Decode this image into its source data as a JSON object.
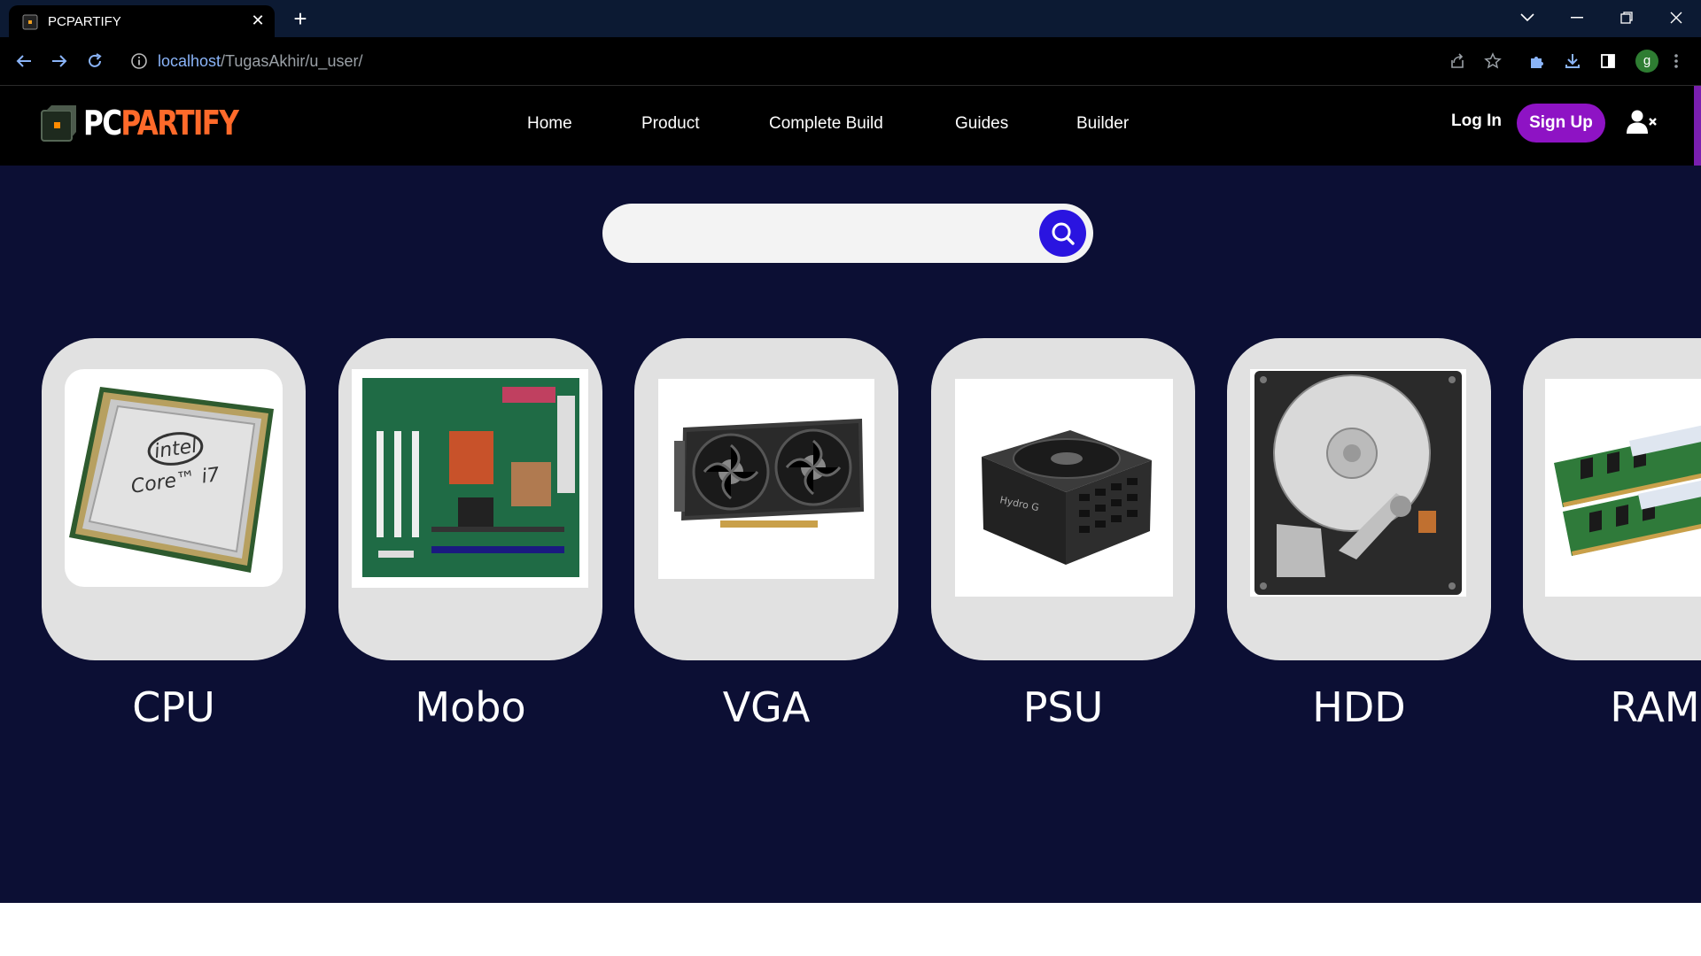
{
  "browser": {
    "tab_title": "PCPARTIFY",
    "url_host": "localhost",
    "url_path": "/TugasAkhir/u_user/",
    "profile_initial": "g"
  },
  "site": {
    "logo_pc": "PC",
    "logo_partify": "PARTIFY",
    "menu": [
      "Home",
      "Product",
      "Complete Build",
      "Guides",
      "Builder"
    ],
    "login": "Log In",
    "signup": "Sign Up"
  },
  "search": {
    "value": "",
    "placeholder": ""
  },
  "categories": [
    {
      "label": "CPU",
      "icon": "cpu-image"
    },
    {
      "label": "Mobo",
      "icon": "motherboard-image"
    },
    {
      "label": "VGA",
      "icon": "graphics-card-image"
    },
    {
      "label": "PSU",
      "icon": "power-supply-image"
    },
    {
      "label": "HDD",
      "icon": "hard-drive-image"
    },
    {
      "label": "RAM",
      "icon": "ram-image"
    }
  ],
  "colors": {
    "main_bg": "#0c0f34",
    "signup_bg": "#8e13c4",
    "search_button": "#2a14e0",
    "card_bg": "#e1e1e1"
  }
}
